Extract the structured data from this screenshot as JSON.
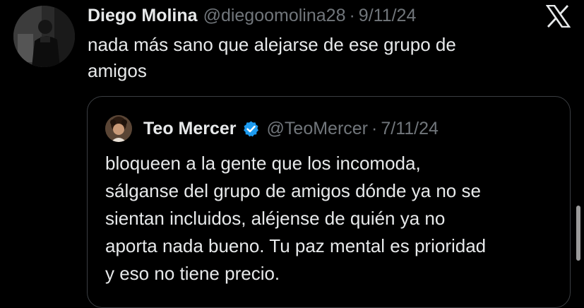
{
  "tweet": {
    "author_name": "Diego Molina",
    "author_handle": "@diegoomolina28",
    "separator": "·",
    "date": "9/11/24",
    "text_line1": "nada más sano que alejarse de ese grupo de",
    "text_line2": "amigos"
  },
  "quoted_tweet": {
    "author_name": "Teo Mercer",
    "verified": true,
    "author_handle": "@TeoMercer",
    "separator": "·",
    "date": "7/11/24",
    "text_lines": [
      "bloqueen a la gente que los incomoda,",
      "sálganse del grupo de amigos dónde ya no se",
      "sientan incluidos, aléjense de quién ya no",
      "aporta nada bueno. Tu paz mental es prioridad",
      "y eso no tiene precio."
    ]
  },
  "icons": {
    "brand": "x-logo-icon",
    "verified": "verified-badge-icon"
  },
  "colors": {
    "background": "#000000",
    "text_primary": "#e7e9ea",
    "text_secondary": "#71767b",
    "border": "#3b3e42",
    "verified_blue": "#1d9bf0"
  }
}
